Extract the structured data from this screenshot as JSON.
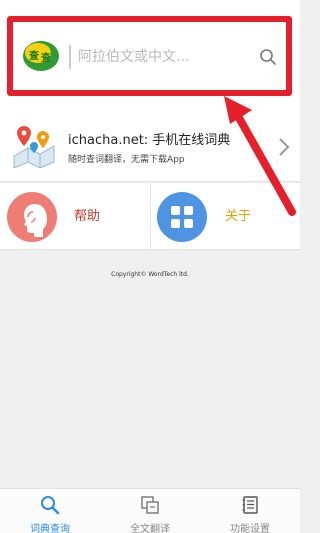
{
  "search": {
    "placeholder": "阿拉伯文或中文...",
    "logo_icon": "chinese-arabic-logo-icon",
    "search_icon": "search-icon"
  },
  "promo": {
    "title": "ichacha.net: 手机在线词典",
    "subtitle": "随时查词翻译，无需下载App",
    "icon": "map-pin-icon"
  },
  "actions": {
    "help_label": "帮助",
    "about_label": "关于",
    "help_icon": "person-profile-icon",
    "about_icon": "grid-icon"
  },
  "copyright": "Copyright© WordTech ltd.",
  "tabs": [
    {
      "label": "词典查询",
      "icon": "search-icon",
      "active": true
    },
    {
      "label": "全文翻译",
      "icon": "translate-icon",
      "active": false
    },
    {
      "label": "功能设置",
      "icon": "notebook-icon",
      "active": false
    }
  ],
  "colors": {
    "annotation_red": "#e5202a",
    "accent_blue": "#2a8be0",
    "help_circle": "#ee7d74",
    "about_circle": "#4f93e3"
  }
}
